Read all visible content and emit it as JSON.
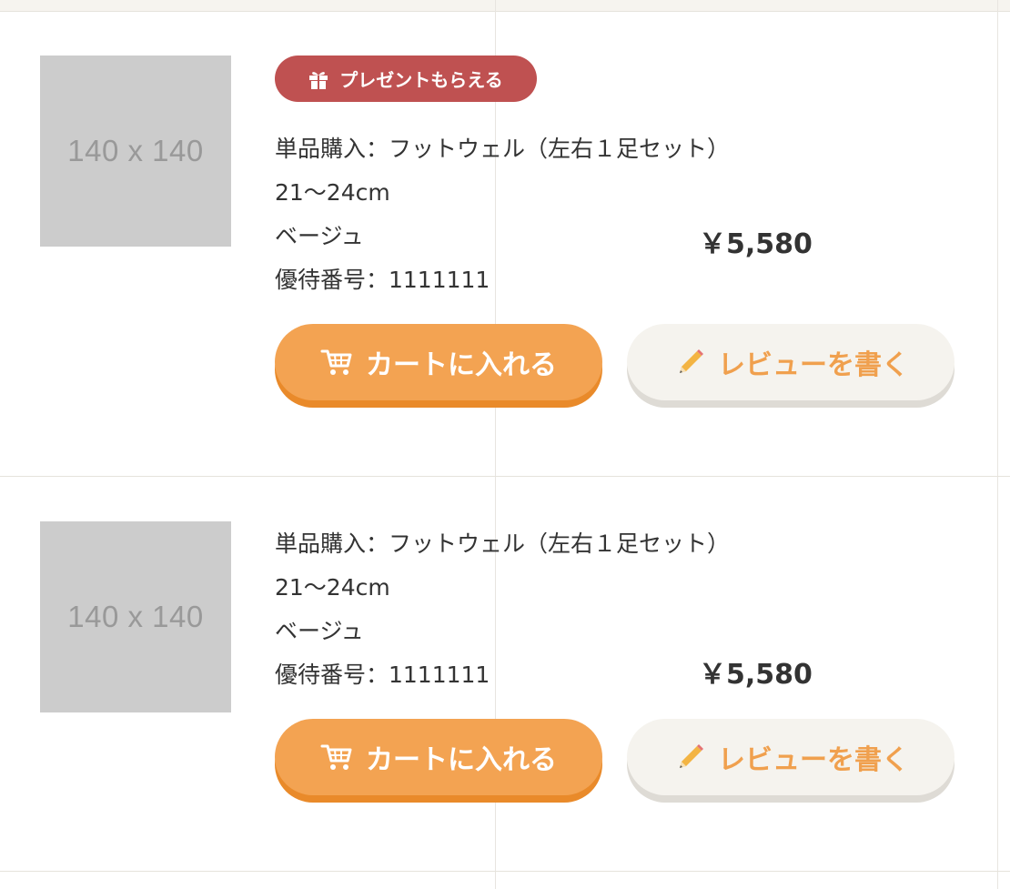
{
  "items": [
    {
      "thumbnail_text": "140 x 140",
      "badge_label": "プレゼントもらえる",
      "name": "単品購入：フットウェル（左右１足セット）",
      "size": "21〜24cm",
      "color": "ベージュ",
      "code": "優待番号：1111111",
      "price": "￥5,580",
      "cart_label": "カートに入れる",
      "review_label": "レビューを書く"
    },
    {
      "thumbnail_text": "140 x 140",
      "name": "単品購入：フットウェル（左右１足セット）",
      "size": "21〜24cm",
      "color": "ベージュ",
      "code": "優待番号：1111111",
      "price": "￥5,580",
      "cart_label": "カートに入れる",
      "review_label": "レビューを書く"
    }
  ],
  "icons": {
    "gift": "gift-icon",
    "cart": "cart-icon",
    "pencil": "pencil-icon"
  },
  "colors": {
    "badge": "#bf5151",
    "cart_button": "#f3a352",
    "review_text": "#f0a04e",
    "review_button": "#f5f3ee"
  }
}
